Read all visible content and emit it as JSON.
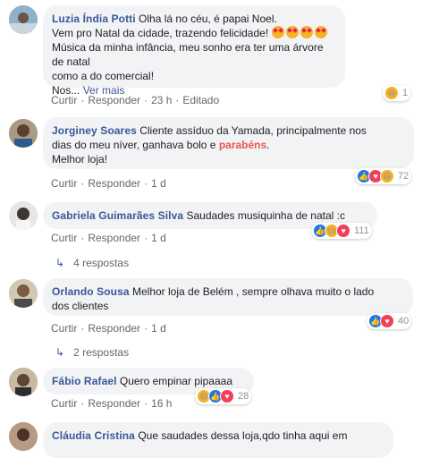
{
  "comments": [
    {
      "author": "Luzia Índia Potti",
      "text_lines": [
        "Olha lá no céu, é papai Noel.",
        "Vem pro Natal da cidade, trazendo felicidade!",
        "Música da minha infância, meu sonho era ter uma árvore de natal",
        "como a do comercial!"
      ],
      "truncation": "Nos...",
      "see_more": "Ver mais",
      "actions": {
        "like": "Curtir",
        "reply": "Responder",
        "time": "23 h",
        "edited": "Editado"
      },
      "reaction_count": "1",
      "reaction_types": [
        "haha-icon"
      ]
    },
    {
      "author": "Jorginey Soares",
      "text_before": "Cliente assíduo da Yamada, principalmente nos",
      "text_line2_before": "dias do meu níver, ganhava bolo e",
      "highlight": "parabéns",
      "text_line2_after": ".",
      "text_line3": "Melhor loja!",
      "actions": {
        "like": "Curtir",
        "reply": "Responder",
        "time": "1 d"
      },
      "reaction_count": "72",
      "reaction_types": [
        "like-icon",
        "love-icon",
        "haha-icon"
      ]
    },
    {
      "author": "Gabriela Guimarães Silva",
      "text": "Saudades musiquinha de natal :c",
      "actions": {
        "like": "Curtir",
        "reply": "Responder",
        "time": "1 d"
      },
      "reaction_count": "111",
      "reaction_types": [
        "like-icon",
        "sad-icon",
        "love-icon"
      ],
      "replies": "4 respostas"
    },
    {
      "author": "Orlando Sousa",
      "text_line1": "Melhor loja de Belém , sempre olhava muito o lado",
      "text_line2": "dos clientes",
      "actions": {
        "like": "Curtir",
        "reply": "Responder",
        "time": "1 d"
      },
      "reaction_count": "40",
      "reaction_types": [
        "like-icon",
        "love-icon"
      ],
      "replies": "2 respostas"
    },
    {
      "author": "Fábio Rafael",
      "text": "Quero empinar pipaaaa",
      "actions": {
        "like": "Curtir",
        "reply": "Responder",
        "time": "16 h"
      },
      "reaction_count": "28",
      "reaction_types": [
        "haha-icon",
        "like-icon",
        "love-icon"
      ]
    },
    {
      "author": "Cláudia Cristina",
      "text": "Que saudades dessa loja,qdo tinha aqui em"
    }
  ],
  "colors": {
    "author": "#385898",
    "bubble": "#f2f3f5",
    "meta": "#606770",
    "highlight": "#e9574d"
  }
}
